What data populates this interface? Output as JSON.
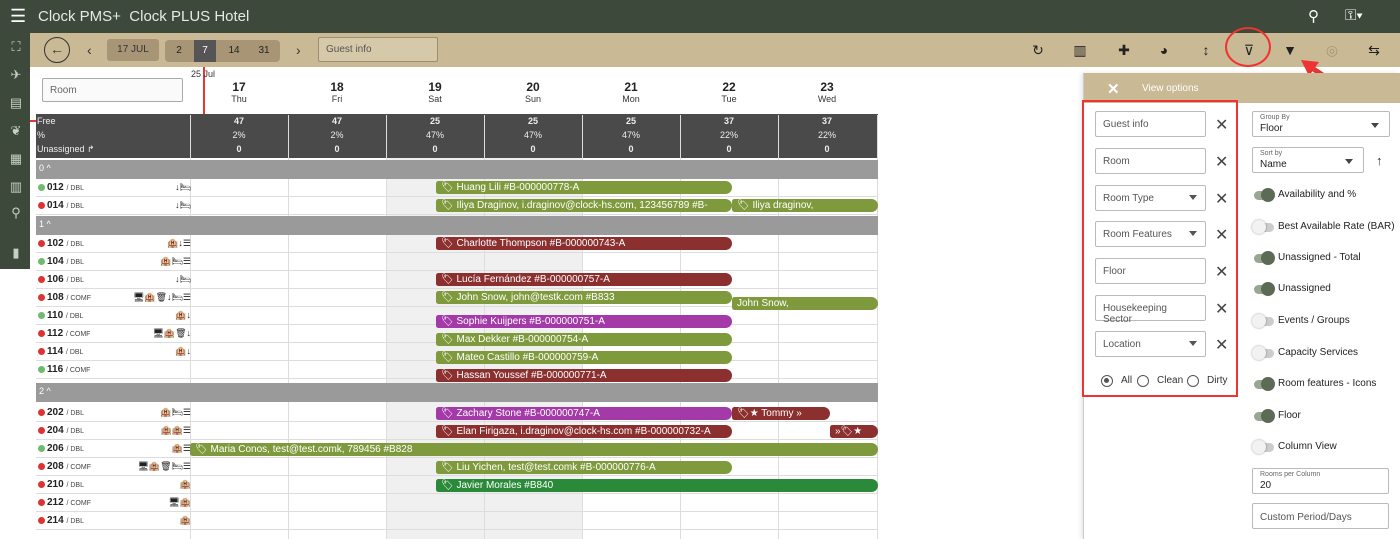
{
  "app": {
    "brand": "Clock PMS+",
    "hotel": "Clock PLUS Hotel"
  },
  "toolbar": {
    "date_label": "17 JUL",
    "periods": [
      "2",
      "7",
      "14",
      "31"
    ],
    "active_period": "7",
    "guest_placeholder": "Guest info"
  },
  "grid": {
    "room_placeholder": "Room",
    "month_label": "25 Jul",
    "days": [
      {
        "num": "17",
        "wd": "Thu"
      },
      {
        "num": "18",
        "wd": "Fri"
      },
      {
        "num": "19",
        "wd": "Sat"
      },
      {
        "num": "20",
        "wd": "Sun"
      },
      {
        "num": "21",
        "wd": "Mon"
      },
      {
        "num": "22",
        "wd": "Tue"
      },
      {
        "num": "23",
        "wd": "Wed"
      }
    ],
    "stats": {
      "free_label": "Free",
      "pct_label": "%",
      "unassigned_label": "Unassigned",
      "free": [
        "47",
        "47",
        "25",
        "25",
        "25",
        "37",
        "37"
      ],
      "pct": [
        "2%",
        "2%",
        "47%",
        "47%",
        "47%",
        "22%",
        "22%"
      ],
      "unassigned": [
        "0",
        "0",
        "0",
        "0",
        "0",
        "0",
        "0"
      ]
    },
    "groups": [
      {
        "label": "0"
      },
      {
        "label": "1"
      },
      {
        "label": "2"
      }
    ],
    "rooms": [
      {
        "num": "012",
        "type": "DBL",
        "icons": "↓🛏",
        "status": "green"
      },
      {
        "num": "014",
        "type": "DBL",
        "icons": "↓🛏",
        "status": "red"
      },
      {
        "num": "102",
        "type": "DBL",
        "icons": "🏨↓☰",
        "status": "red"
      },
      {
        "num": "104",
        "type": "DBL",
        "icons": "🏨🛏☰",
        "status": "green"
      },
      {
        "num": "106",
        "type": "DBL",
        "icons": "↓🛏",
        "status": "red"
      },
      {
        "num": "108",
        "type": "COMF",
        "icons": "🖥🏨🗑↓🛏☰",
        "status": "red"
      },
      {
        "num": "110",
        "type": "DBL",
        "icons": "🏨↓",
        "status": "green"
      },
      {
        "num": "112",
        "type": "COMF",
        "icons": "🖥🏨🗑↓",
        "status": "red"
      },
      {
        "num": "114",
        "type": "DBL",
        "icons": "🏨↓",
        "status": "red"
      },
      {
        "num": "116",
        "type": "COMF",
        "icons": "",
        "status": "green"
      },
      {
        "num": "202",
        "type": "DBL",
        "icons": "🏨🛏☰",
        "status": "red"
      },
      {
        "num": "204",
        "type": "DBL",
        "icons": "🏨🏨☰",
        "status": "red"
      },
      {
        "num": "206",
        "type": "DBL",
        "icons": "🏨☰",
        "status": "green"
      },
      {
        "num": "208",
        "type": "COMF",
        "icons": "🖥🏨🗑🛏☰",
        "status": "red"
      },
      {
        "num": "210",
        "type": "DBL",
        "icons": "🏨",
        "status": "red"
      },
      {
        "num": "212",
        "type": "COMF",
        "icons": "🖥🏨",
        "status": "red"
      },
      {
        "num": "214",
        "type": "DBL",
        "icons": "🏨",
        "status": "red"
      }
    ],
    "reservations": [
      "Huang Lili #B-000000778-A",
      "Iliya Draginov, i.draginov@clock-hs.com, 123456789 #B-",
      "Iliya draginov,",
      "Charlotte Thompson #B-000000743-A",
      "Lucía Fernández #B-000000757-A",
      "John Snow, john@testk.com #B833",
      "John Snow,",
      "Sophie Kuijpers #B-000000751-A",
      "Max Dekker #B-000000754-A",
      "Mateo Castillo #B-000000759-A",
      "Hassan Youssef #B-000000771-A",
      "Zachary Stone #B-000000747-A",
      "Tommy",
      "Elan Firigaza, i.draginov@clock-hs.com #B-000000732-A",
      "Maria Conos, test@test.comk, 789456 #B828",
      "Liu Yichen, test@test.comk #B-000000776-A",
      "Javier Morales #B840"
    ]
  },
  "panel": {
    "title": "View options",
    "filters": [
      "Guest info",
      "Room",
      "Room Type",
      "Room Features",
      "Floor",
      "Housekeeping Sector",
      "Location"
    ],
    "hk": {
      "all": "All",
      "clean": "Clean",
      "dirty": "Dirty"
    },
    "group_by": {
      "label": "Group By",
      "value": "Floor"
    },
    "sort_by": {
      "label": "Sort by",
      "value": "Name"
    },
    "toggles": [
      {
        "label": "Availability and %",
        "on": true
      },
      {
        "label": "Best Available Rate (BAR)",
        "on": false
      },
      {
        "label": "Unassigned - Total",
        "on": true
      },
      {
        "label": "Unassigned",
        "on": true
      },
      {
        "label": "Events / Groups",
        "on": false
      },
      {
        "label": "Capacity Services",
        "on": false
      },
      {
        "label": "Room features - Icons",
        "on": true
      },
      {
        "label": "Floor",
        "on": true
      },
      {
        "label": "Column View",
        "on": false
      }
    ],
    "rooms_per_column": {
      "label": "Rooms per Column",
      "value": "20"
    },
    "custom_period_placeholder": "Custom Period/Days"
  }
}
